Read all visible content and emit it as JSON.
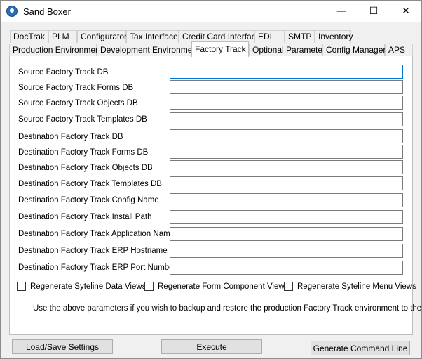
{
  "window": {
    "title": "Sand Boxer",
    "minimize_glyph": "—",
    "maximize_glyph": "☐",
    "close_glyph": "✕"
  },
  "tabs": {
    "row1": [
      "DocTrak",
      "PLM",
      "Configurator",
      "Tax Interface",
      "Credit Card Interface",
      "EDI",
      "SMTP",
      "Inventory"
    ],
    "row2": [
      "Production Environment",
      "Development Environment",
      "Factory Track",
      "Optional Parameters",
      "Config Manager",
      "APS"
    ],
    "active": "Factory Track"
  },
  "fields": [
    {
      "label": "Source Factory Track DB",
      "value": ""
    },
    {
      "label": "Source Factory Track Forms DB",
      "value": ""
    },
    {
      "label": "Source Factory Track Objects DB",
      "value": ""
    },
    {
      "label": "Source Factory Track Templates DB",
      "value": ""
    },
    {
      "label": "Destination Factory Track DB",
      "value": ""
    },
    {
      "label": "Destination Factory Track Forms DB",
      "value": ""
    },
    {
      "label": "Destination Factory Track Objects DB",
      "value": ""
    },
    {
      "label": "Destination Factory Track Templates DB",
      "value": ""
    },
    {
      "label": "Destination Factory Track Config Name",
      "value": ""
    },
    {
      "label": "Destination Factory Track Install Path",
      "value": ""
    },
    {
      "label": "Destination Factory Track Application Name",
      "value": ""
    },
    {
      "label": "Destination Factory Track ERP Hostname",
      "value": ""
    },
    {
      "label": "Destination Factory Track ERP Port Number",
      "value": ""
    }
  ],
  "checkboxes": [
    {
      "label": "Regenerate Syteline Data Views",
      "checked": false
    },
    {
      "label": "Regenerate Form Component Views",
      "checked": false
    },
    {
      "label": "Regenerate Syteline Menu Views",
      "checked": false
    }
  ],
  "note": "Use the above parameters if you wish to backup and restore the production Factory Track environment to the",
  "buttons": {
    "load_save": "Load/Save Settings",
    "execute": "Execute",
    "generate": "Generate Command Line"
  }
}
